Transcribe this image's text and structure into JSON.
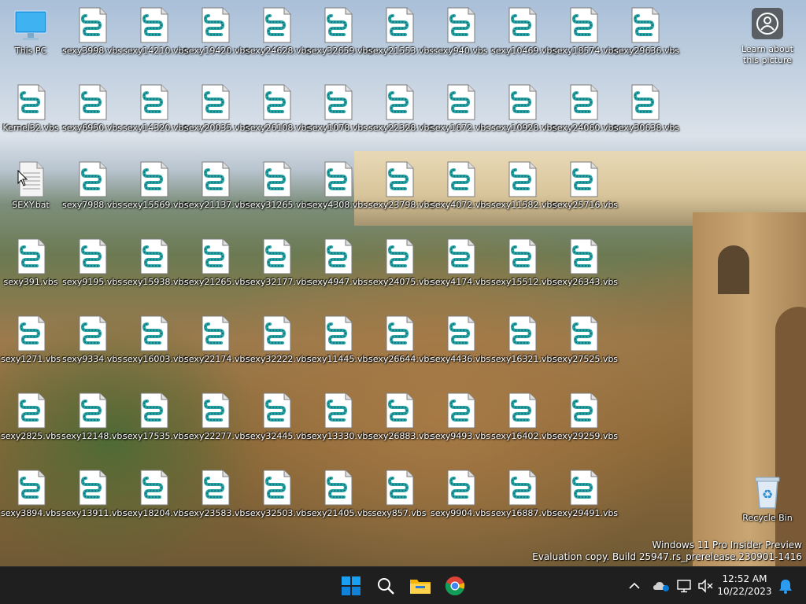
{
  "desktop": {
    "columns": [
      [
        "This PC",
        "Kernel32.vbs",
        "SEXY.bat",
        "sexy391.vbs",
        "sexy1271.vbs",
        "sexy2825.vbs",
        "sexy3894.vbs"
      ],
      [
        "sexy3998.vbs",
        "sexy6950.vbs",
        "sexy7988.vbs",
        "sexy9195.vbs",
        "sexy9334.vbs",
        "sexy12148.vbs",
        "sexy13911.vbs"
      ],
      [
        "sexy14210.vbs",
        "sexy14320.vbs",
        "sexy15569.vbs",
        "sexy15938.vbs",
        "sexy16003.vbs",
        "sexy17535.vbs",
        "sexy18204.vbs"
      ],
      [
        "sexy19420.vbs",
        "sexy20035.vbs",
        "sexy21137.vbs",
        "sexy21265.vbs",
        "sexy22174.vbs",
        "sexy22277.vbs",
        "sexy23583.vbs"
      ],
      [
        "sexy24628.vbs",
        "sexy26108.vbs",
        "sexy31265.vbs",
        "sexy32177.vbs",
        "sexy32222.vbs",
        "sexy32445.vbs",
        "sexy32503.vbs"
      ],
      [
        "sexy32659.vbs",
        "sexy1078.vbs",
        "sexy4308.vbs",
        "sexy4947.vbs",
        "sexy11445.vbs",
        "sexy13330.vbs",
        "sexy21405.vbs"
      ],
      [
        "sexy21553.vbs",
        "sexy22328.vbs",
        "sexy23798.vbs",
        "sexy24075.vbs",
        "sexy26644.vbs",
        "sexy26883.vbs",
        "sexy857.vbs"
      ],
      [
        "sexy940.vbs",
        "sexy1672.vbs",
        "sexy4072.vbs",
        "sexy4174.vbs",
        "sexy4436.vbs",
        "sexy9493.vbs",
        "sexy9904.vbs"
      ],
      [
        "sexy10469.vbs",
        "sexy10928.vbs",
        "sexy11582.vbs",
        "sexy15512.vbs",
        "sexy16321.vbs",
        "sexy16402.vbs",
        "sexy16887.vbs"
      ],
      [
        "sexy18574.vbs",
        "sexy24060.vbs",
        "sexy25716.vbs",
        "sexy26343.vbs",
        "sexy27525.vbs",
        "sexy29259.vbs",
        "sexy29491.vbs"
      ],
      [
        "sexy29636.vbs",
        "sexy30638.vbs"
      ]
    ],
    "learn_about_picture": "Learn about\nthis picture",
    "recycle_bin": "Recycle Bin",
    "watermark_line1": "Windows 11 Pro Insider Preview",
    "watermark_line2": "Evaluation copy. Build 25947.rs_prerelease.230901-1416"
  },
  "taskbar": {
    "apps": [
      "start-icon",
      "search-icon",
      "file-explorer-icon",
      "chrome-icon"
    ],
    "tray": [
      "chevron-up-icon",
      "onedrive-icon",
      "network-icon",
      "volume-muted-icon"
    ],
    "time": "12:52 AM",
    "date": "10/22/2023",
    "accent": "#0078d4"
  }
}
